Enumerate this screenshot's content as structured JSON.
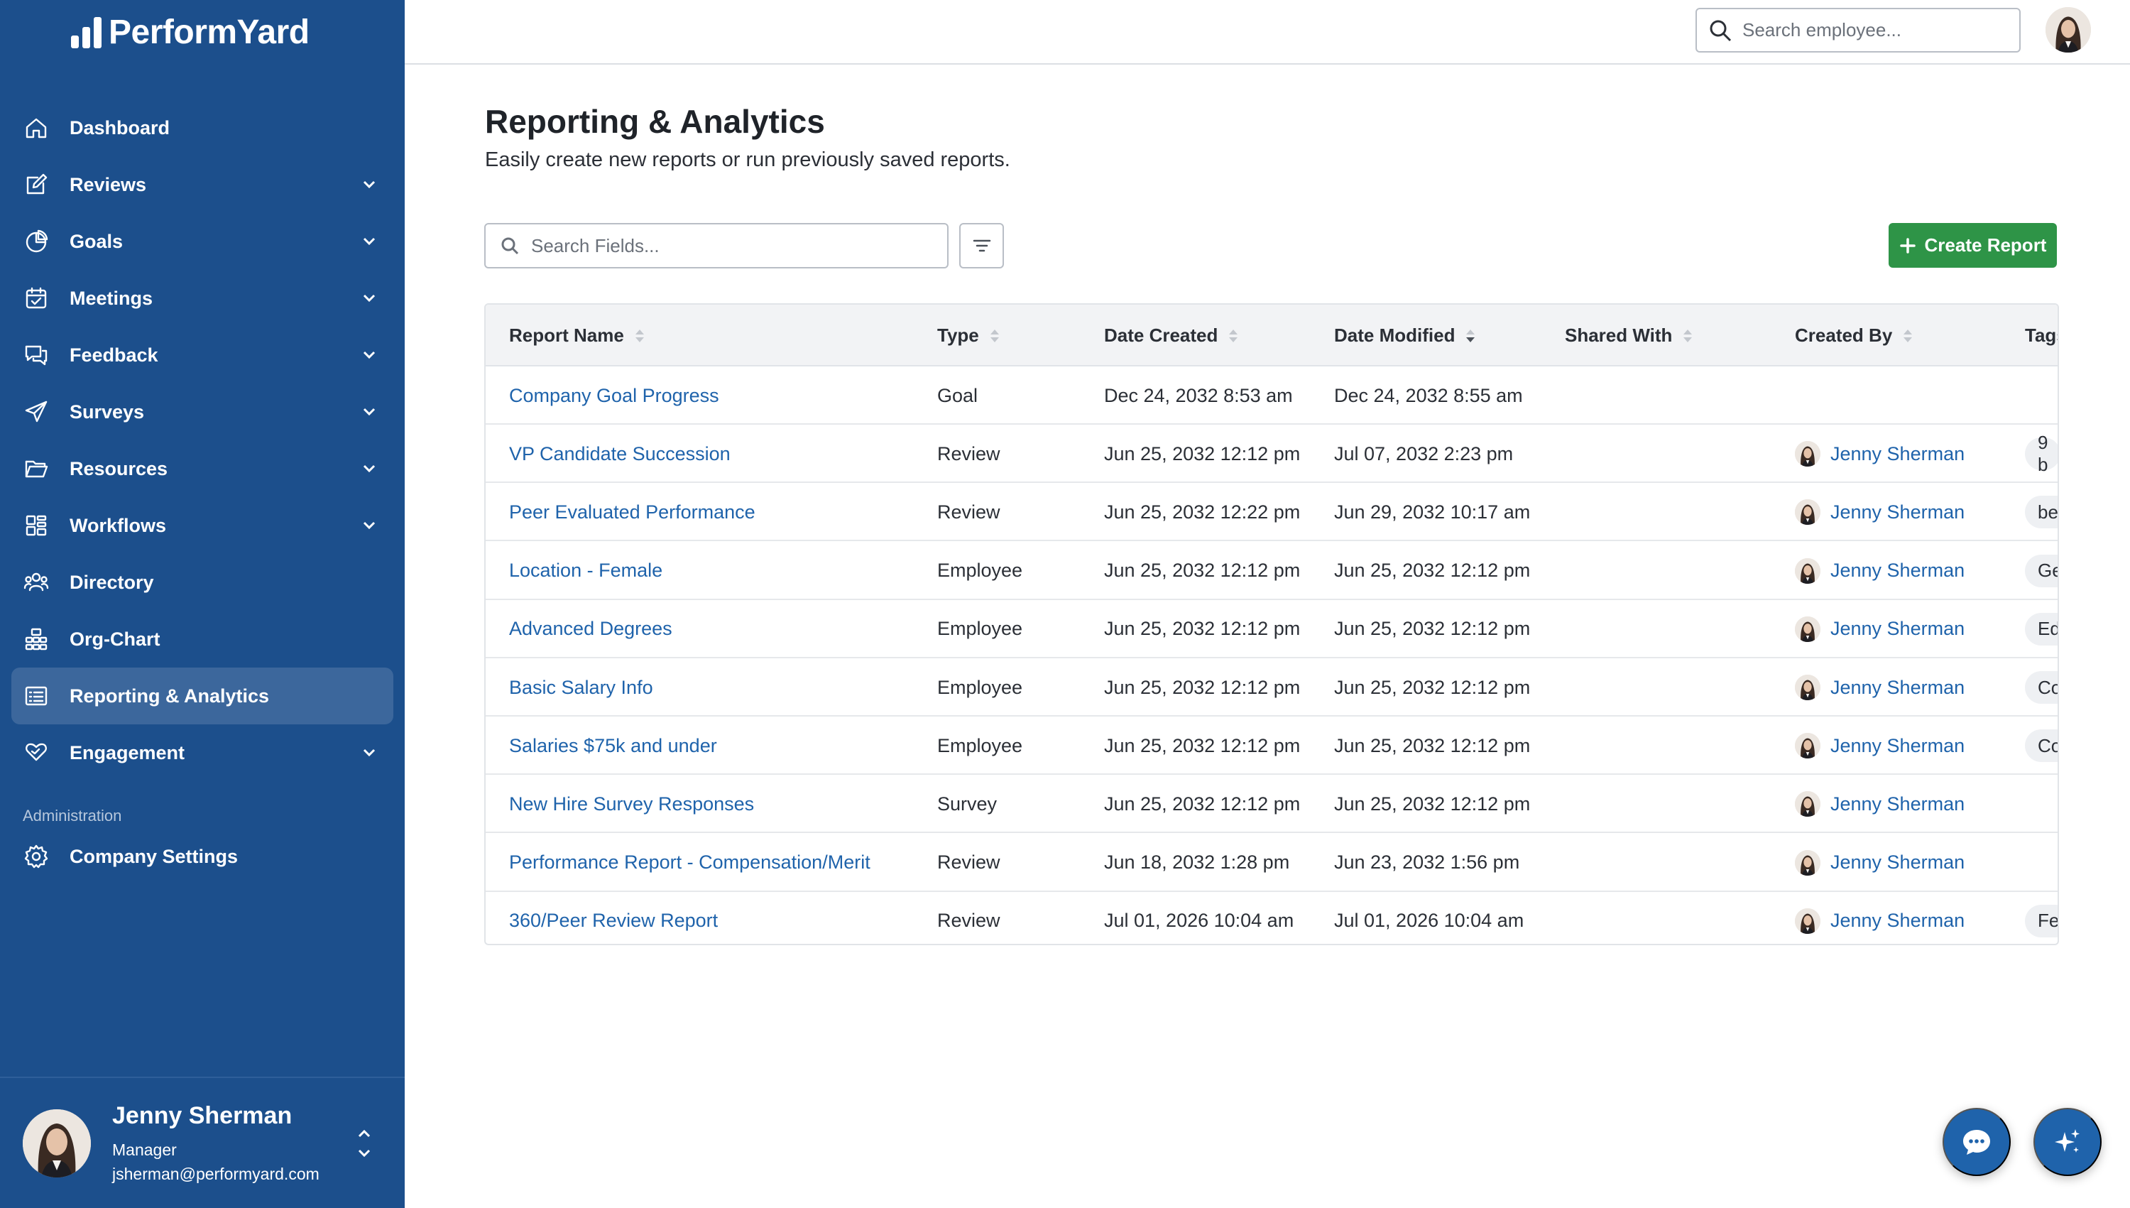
{
  "app": {
    "brand": "PerformYard"
  },
  "sidebar": {
    "items": [
      {
        "label": "Dashboard",
        "icon": "home-icon",
        "has_chevron": false
      },
      {
        "label": "Reviews",
        "icon": "edit-icon",
        "has_chevron": true
      },
      {
        "label": "Goals",
        "icon": "pie-chart-icon",
        "has_chevron": true
      },
      {
        "label": "Meetings",
        "icon": "calendar-icon",
        "has_chevron": true
      },
      {
        "label": "Feedback",
        "icon": "chat-bubbles-icon",
        "has_chevron": true
      },
      {
        "label": "Surveys",
        "icon": "send-icon",
        "has_chevron": true
      },
      {
        "label": "Resources",
        "icon": "folder-icon",
        "has_chevron": true
      },
      {
        "label": "Workflows",
        "icon": "workflow-icon",
        "has_chevron": true
      },
      {
        "label": "Directory",
        "icon": "people-icon",
        "has_chevron": false
      },
      {
        "label": "Org-Chart",
        "icon": "org-chart-icon",
        "has_chevron": false
      },
      {
        "label": "Reporting & Analytics",
        "icon": "report-icon",
        "has_chevron": false,
        "active": true
      },
      {
        "label": "Engagement",
        "icon": "heart-hands-icon",
        "has_chevron": true
      }
    ],
    "admin_heading": "Administration",
    "admin_items": [
      {
        "label": "Company Settings",
        "icon": "gear-icon"
      }
    ],
    "user": {
      "name": "Jenny Sherman",
      "role": "Manager",
      "email": "jsherman@performyard.com"
    }
  },
  "topbar": {
    "search_placeholder": "Search employee..."
  },
  "main": {
    "title": "Reporting & Analytics",
    "subtitle": "Easily create new reports or run previously saved reports.",
    "search_placeholder": "Search Fields...",
    "create_button": "Create Report",
    "columns": [
      {
        "label": "Report Name",
        "sort": "none"
      },
      {
        "label": "Type",
        "sort": "none"
      },
      {
        "label": "Date Created",
        "sort": "none"
      },
      {
        "label": "Date Modified",
        "sort": "desc"
      },
      {
        "label": "Shared With",
        "sort": "none"
      },
      {
        "label": "Created By",
        "sort": "none"
      },
      {
        "label": "Tags",
        "sort": "none"
      }
    ],
    "rows": [
      {
        "name": "Company Goal Progress",
        "type": "Goal",
        "created": "Dec 24, 2032 8:53 am",
        "modified": "Dec 24, 2032 8:55 am",
        "shared": "",
        "creator": "",
        "tag": ""
      },
      {
        "name": "VP Candidate Succession",
        "type": "Review",
        "created": "Jun 25, 2032 12:12 pm",
        "modified": "Jul 07, 2032 2:23 pm",
        "shared": "",
        "creator": "Jenny Sherman",
        "tag": "9 b"
      },
      {
        "name": "Peer Evaluated Performance",
        "type": "Review",
        "created": "Jun 25, 2032 12:22 pm",
        "modified": "Jun 29, 2032 10:17 am",
        "shared": "",
        "creator": "Jenny Sherman",
        "tag": "bel"
      },
      {
        "name": "Location - Female",
        "type": "Employee",
        "created": "Jun 25, 2032 12:12 pm",
        "modified": "Jun 25, 2032 12:12 pm",
        "shared": "",
        "creator": "Jenny Sherman",
        "tag": "Ge"
      },
      {
        "name": "Advanced Degrees",
        "type": "Employee",
        "created": "Jun 25, 2032 12:12 pm",
        "modified": "Jun 25, 2032 12:12 pm",
        "shared": "",
        "creator": "Jenny Sherman",
        "tag": "Ed"
      },
      {
        "name": "Basic Salary Info",
        "type": "Employee",
        "created": "Jun 25, 2032 12:12 pm",
        "modified": "Jun 25, 2032 12:12 pm",
        "shared": "",
        "creator": "Jenny Sherman",
        "tag": "Co"
      },
      {
        "name": "Salaries $75k and under",
        "type": "Employee",
        "created": "Jun 25, 2032 12:12 pm",
        "modified": "Jun 25, 2032 12:12 pm",
        "shared": "",
        "creator": "Jenny Sherman",
        "tag": "Co"
      },
      {
        "name": "New Hire Survey Responses",
        "type": "Survey",
        "created": "Jun 25, 2032 12:12 pm",
        "modified": "Jun 25, 2032 12:12 pm",
        "shared": "",
        "creator": "Jenny Sherman",
        "tag": ""
      },
      {
        "name": "Performance Report - Compensation/Merit",
        "type": "Review",
        "created": "Jun 18, 2032 1:28 pm",
        "modified": "Jun 23, 2032 1:56 pm",
        "shared": "",
        "creator": "Jenny Sherman",
        "tag": ""
      },
      {
        "name": "360/Peer Review Report",
        "type": "Review",
        "created": "Jul 01, 2026 10:04 am",
        "modified": "Jul 01, 2026 10:04 am",
        "shared": "",
        "creator": "Jenny Sherman",
        "tag": "Fe"
      }
    ]
  },
  "colors": {
    "sidebar_bg": "#1c4f8c",
    "link": "#1f63ab",
    "create_button": "#2e9447",
    "fab": "#1f63ab"
  },
  "floating": {
    "chat_icon": "chat-icon",
    "ai_icon": "sparkle-icon"
  }
}
